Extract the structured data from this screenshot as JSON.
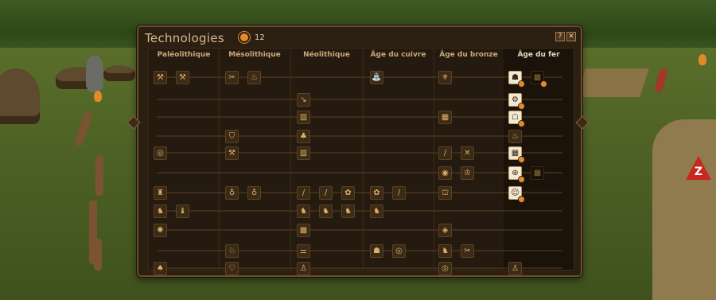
{
  "panel": {
    "title": "Technologies",
    "points": "12",
    "help_label": "?",
    "close_label": "✕"
  },
  "eras": [
    {
      "name": "Paléolithique"
    },
    {
      "name": "Mésolithique"
    },
    {
      "name": "Néolithique"
    },
    {
      "name": "Âge du cuivre"
    },
    {
      "name": "Âge du bronze"
    },
    {
      "name": "Âge du fer"
    }
  ],
  "icons": {
    "points": "sun-icon",
    "help": "question-icon",
    "close": "close-icon",
    "hazard": "warning-icon"
  },
  "colors": {
    "accent": "#e78a2c",
    "text": "#d6b992",
    "panel_bg": "#2b1f12",
    "warning": "#c8261e"
  },
  "hazard": {
    "label": "Z"
  }
}
